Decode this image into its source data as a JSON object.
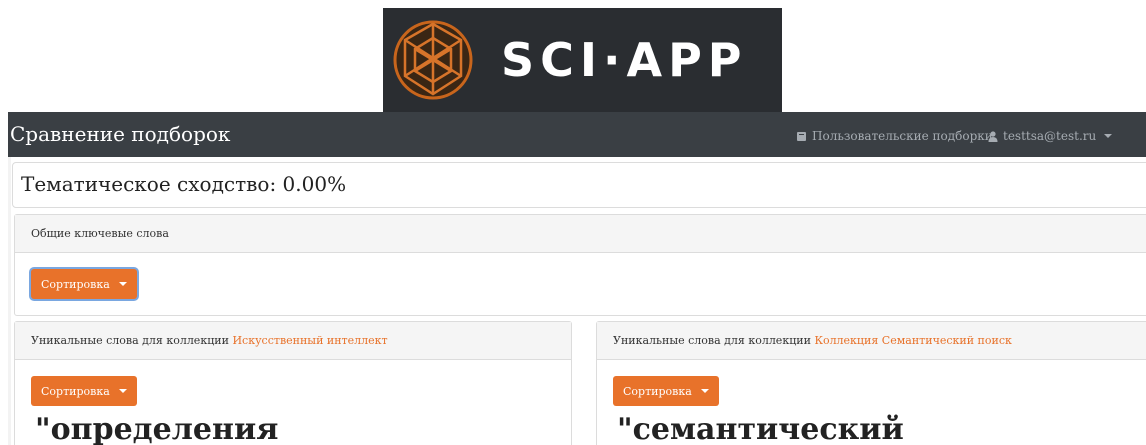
{
  "logo": {
    "text": "SCI·APP",
    "icon": "globe-logo-icon"
  },
  "navbar": {
    "title": "Сравнение подборок",
    "user_collections_label": "Пользовательские подборки",
    "user_collections_icon": "book-icon",
    "user_label": "testtsa@test.ru",
    "user_icon": "user-icon"
  },
  "similarity": {
    "label": "Тематическое сходство: 0.00%"
  },
  "common": {
    "header": "Общие ключевые слова",
    "sort_label": "Сортировка"
  },
  "left": {
    "header_prefix": "Уникальные слова для коллекции",
    "collection_name": "Искусственный интеллект",
    "sort_label": "Сортировка",
    "first_word": "\"определения"
  },
  "right": {
    "header_prefix": "Уникальные слова для коллекции",
    "collection_name": "Коллекция Семантический поиск",
    "sort_label": "Сортировка",
    "first_word": "\"семантический"
  },
  "colors": {
    "accent": "#e8722a",
    "navbar": "#3a3f44",
    "logo_bg": "#2a2d31"
  }
}
